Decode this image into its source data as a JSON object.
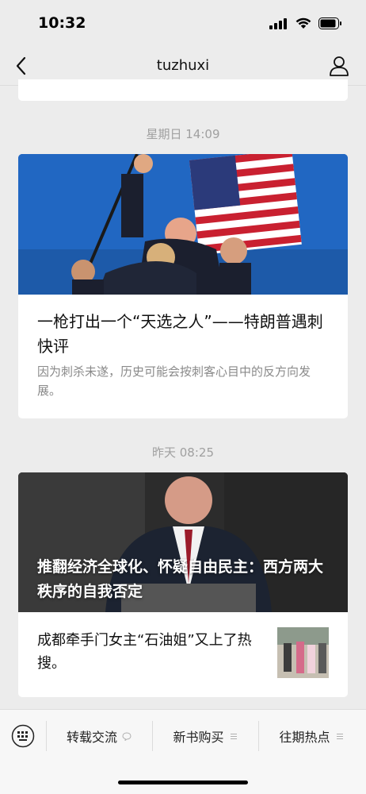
{
  "status_bar": {
    "time": "10:32"
  },
  "nav": {
    "title": "tuzhuxi"
  },
  "feed": {
    "messages": [
      {
        "timestamp": "星期日 14:09",
        "title": "一枪打出一个“天选之人”——特朗普遇刺快评",
        "description": "因为刺杀未遂，历史可能会按刺客心目中的反方向发展。"
      },
      {
        "timestamp": "昨天 08:25",
        "headline": "推翻经济全球化、怀疑自由民主：西方两大秩序的自我否定",
        "sub_item": "成都牵手门女主“石油姐”又上了热搜。"
      }
    ]
  },
  "bottom_menu": {
    "items": [
      {
        "label": "转载交流",
        "suffix_icon": "speech-bubble-icon"
      },
      {
        "label": "新书购买",
        "suffix_icon": "list-icon"
      },
      {
        "label": "往期热点",
        "suffix_icon": "list-icon"
      }
    ]
  },
  "colors": {
    "background": "#ececec",
    "card": "#ffffff",
    "muted": "#8a8a8a",
    "timestamp": "#a0a0a0"
  }
}
